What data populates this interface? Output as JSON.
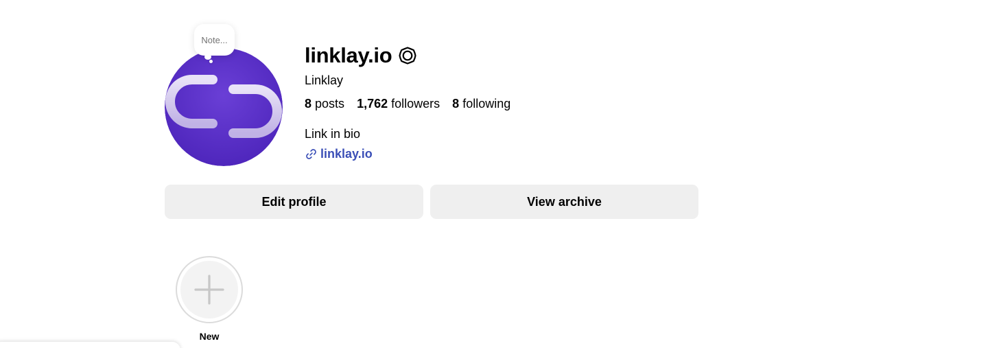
{
  "profile": {
    "username": "linklay.io",
    "full_name": "Linklay",
    "note_placeholder": "Note...",
    "avatar_icon": "link-chain-logo",
    "avatar_color": "#5a2ec8"
  },
  "stats": {
    "posts_count": "8",
    "posts_label": "posts",
    "followers_count": "1,762",
    "followers_label": "followers",
    "following_count": "8",
    "following_label": "following"
  },
  "bio": {
    "text": "Link in bio",
    "link_text": "linklay.io",
    "link_icon": "link-icon",
    "link_color": "#3b4fb7"
  },
  "actions": {
    "edit_profile": "Edit profile",
    "view_archive": "View archive"
  },
  "highlights": {
    "new_label": "New",
    "new_icon": "plus-icon"
  }
}
